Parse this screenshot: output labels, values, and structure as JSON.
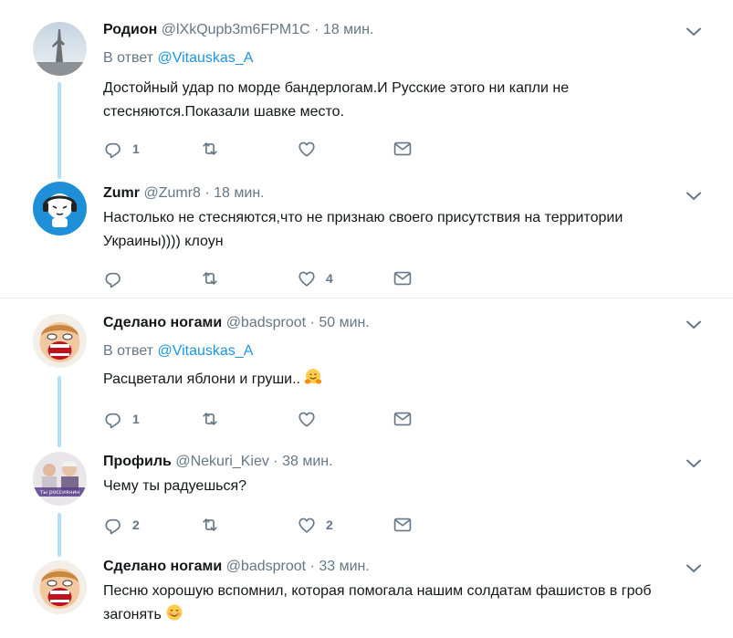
{
  "tweets": [
    {
      "name": "Родион",
      "handle": "@lXkQupb3m6FPM1C",
      "time": "18 мин.",
      "reply_prefix": "В ответ",
      "reply_to": "@Vitauskas_A",
      "text": "Достойный удар по морде бандерлогам.И Русские этого ни капли не стесняются.Показали шавке место.",
      "reply_count": "1",
      "retweet_count": "",
      "like_count": ""
    },
    {
      "name": "Zumr",
      "handle": "@Zumr8",
      "time": "18 мин.",
      "text": "Настолько не стесняются,что не признаю своего присутствия на территории Украины)))) клоун",
      "reply_count": "",
      "retweet_count": "",
      "like_count": "4"
    },
    {
      "name": "Сделано ногами",
      "handle": "@badsproot",
      "time": "50 мин.",
      "reply_prefix": "В ответ",
      "reply_to": "@Vitauskas_A",
      "text": "Расцветали яблони и груши..",
      "reply_count": "1",
      "retweet_count": "",
      "like_count": ""
    },
    {
      "name": "Профиль",
      "handle": "@Nekuri_Kiev",
      "time": "38 мин.",
      "text": "Чему ты радуешься?",
      "reply_count": "2",
      "retweet_count": "",
      "like_count": "2"
    },
    {
      "name": "Сделано ногами",
      "handle": "@badsproot",
      "time": "33 мин.",
      "text": "Песню хорошую вспомнил, которая помогала нашим солдатам фашистов в гроб загонять"
    }
  ],
  "separator_dot": "·",
  "colors": {
    "link": "#1b95e0",
    "muted": "#657786",
    "thread_line": "#b3e0f8",
    "border": "#e6ecf0"
  },
  "icons": [
    "reply-icon",
    "retweet-icon",
    "like-icon",
    "dm-icon",
    "chevron-down-icon",
    "hugging-face-emoji",
    "smiling-face-emoji"
  ]
}
